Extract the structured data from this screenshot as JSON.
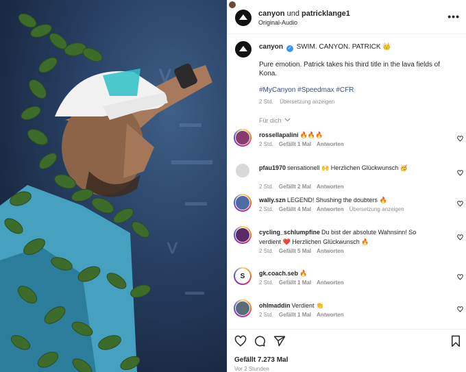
{
  "header": {
    "user_primary": "canyon",
    "conjunction": "und",
    "user_secondary": "patricklange1",
    "audio": "Original-Audio",
    "more_glyph": "•••"
  },
  "caption": {
    "username": "canyon",
    "headline": "SWIM. CANYON. PATRICK",
    "headline_emoji": "👑",
    "body": "Pure emotion. Patrick takes his third title in the lava fields of Kona.",
    "hashtags": "#MyCanyon #Speedmax #CFR",
    "time": "2 Std.",
    "translate": "Übersetzung anzeigen"
  },
  "for_you_label": "Für dich",
  "comments": [
    {
      "user": "rossellapalini",
      "text": "🔥🔥🔥",
      "time": "2 Std.",
      "likes": "Gefällt 1 Mal",
      "reply": "Antworten",
      "translate": "",
      "avatar_color": "#8a3b6e"
    },
    {
      "user": "pfau1970",
      "text": "sensationell 🙌 Herzlichen Glückwunsch 🥳",
      "time": "2 Std.",
      "likes": "Gefällt 2 Mal",
      "reply": "Antworten",
      "translate": "",
      "avatar_color": "#d9d9d9"
    },
    {
      "user": "wally.szn",
      "text": "LEGEND! Shushing the doubters 🔥",
      "time": "2 Std.",
      "likes": "Gefällt 4 Mal",
      "reply": "Antworten",
      "translate": "Übersetzung anzeigen",
      "avatar_color": "#4c6aa3"
    },
    {
      "user": "cycling_schlumpfine",
      "text": "Du bist der absolute Wahnsinn! So verdient ❤️ Herzlichen Glückwunsch 🔥",
      "time": "2 Std.",
      "likes": "Gefällt 5 Mal",
      "reply": "Antworten",
      "translate": "",
      "avatar_color": "#5b2a68"
    },
    {
      "user": "gk.coach.seb",
      "text": "🔥",
      "time": "2 Std.",
      "likes": "Gefällt 1 Mal",
      "reply": "Antworten",
      "translate": "",
      "avatar_color": "#ffffff",
      "avatar_letter": "S"
    },
    {
      "user": "ohlmaddin",
      "text": "Verdient 👏",
      "time": "2 Std.",
      "likes": "Gefällt 1 Mal",
      "reply": "Antworten",
      "translate": "",
      "avatar_color": "#5a6b7a"
    }
  ],
  "footer": {
    "likes": "Gefällt 7.273 Mal",
    "ago": "Vor 2 Stunden"
  },
  "icons": [
    "heart-icon",
    "comment-icon",
    "share-icon",
    "bookmark-icon",
    "verified-icon",
    "chevron-down-icon",
    "more-icon"
  ]
}
